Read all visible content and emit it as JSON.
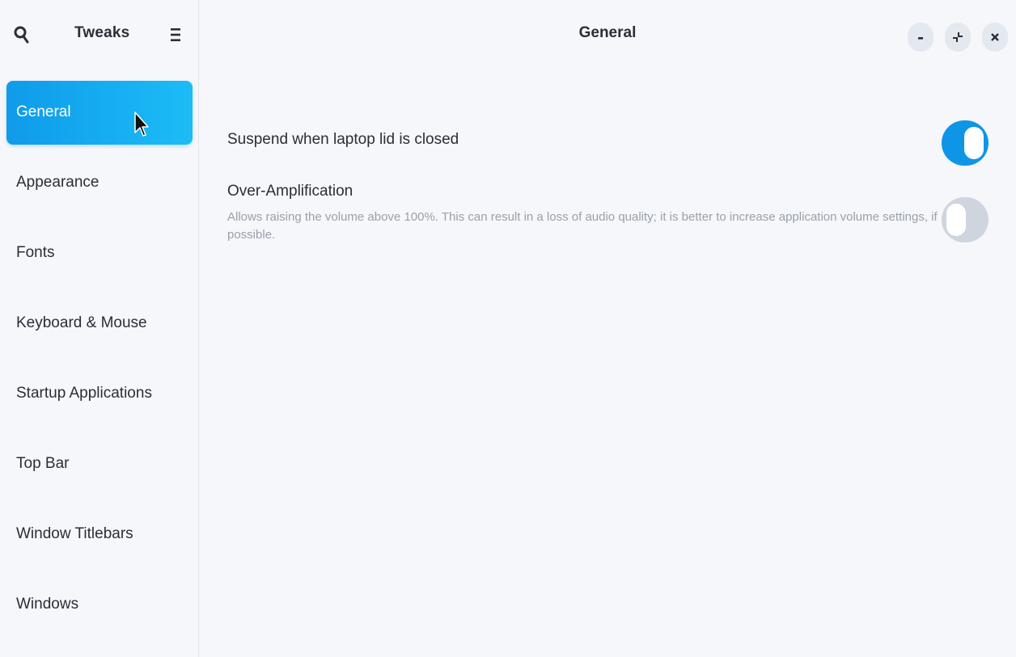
{
  "sidebar": {
    "title": "Tweaks",
    "items": [
      {
        "label": "General"
      },
      {
        "label": "Appearance"
      },
      {
        "label": "Fonts"
      },
      {
        "label": "Keyboard & Mouse"
      },
      {
        "label": "Startup Applications"
      },
      {
        "label": "Top Bar"
      },
      {
        "label": "Window Titlebars"
      },
      {
        "label": "Windows"
      }
    ],
    "active_index": 0
  },
  "main": {
    "title": "General",
    "settings": [
      {
        "label": "Suspend when laptop lid is closed",
        "enabled": true
      },
      {
        "label": "Over-Amplification",
        "description": "Allows raising the volume above 100%. This can result in a loss of audio quality; it is better to increase application volume settings, if possible.",
        "enabled": false
      }
    ]
  },
  "icons": {
    "search": "search-icon",
    "menu": "hamburger-menu-icon",
    "minimize": "minimize-icon",
    "restore": "restore-icon",
    "close": "close-icon"
  },
  "colors": {
    "accent": "#0f95e6",
    "accent_light": "#1cbcf7",
    "toggle_off": "#cfd5de",
    "background": "#f5f7fb",
    "description": "#9aa0aa"
  }
}
